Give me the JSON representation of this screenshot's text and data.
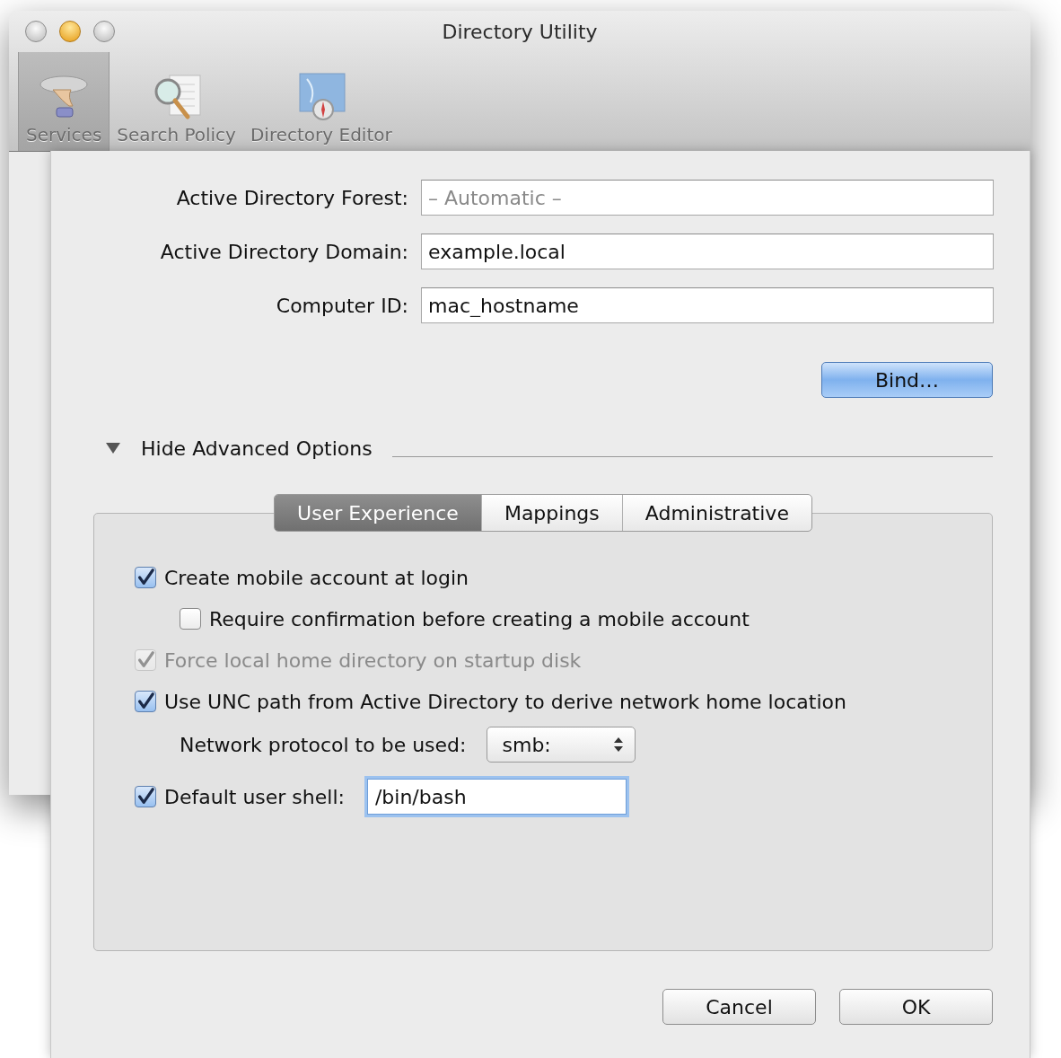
{
  "window": {
    "title": "Directory Utility"
  },
  "toolbar": [
    {
      "label": "Services",
      "selected": true,
      "kind": "services"
    },
    {
      "label": "Search Policy",
      "selected": false,
      "kind": "search"
    },
    {
      "label": "Directory Editor",
      "selected": false,
      "kind": "editor"
    }
  ],
  "sheet": {
    "fields": [
      {
        "label": "Active Directory Forest:",
        "placeholder": "– Automatic –"
      },
      {
        "label": "Active Directory Domain:",
        "value": "example.local"
      },
      {
        "label": "Computer ID:",
        "value": "mac_hostname"
      }
    ],
    "bind_button": {
      "label": "Bind…",
      "default": true
    },
    "disclosure": {
      "label": "Hide Advanced Options",
      "expanded": true
    },
    "tabs": [
      {
        "label": "User Experience",
        "selected": true
      },
      {
        "label": "Mappings",
        "selected": false
      },
      {
        "label": "Administrative",
        "selected": false
      }
    ],
    "options": [
      {
        "kind": "checkbox",
        "label": "Create mobile account at login",
        "checked": true,
        "disabled": false,
        "children": [
          {
            "kind": "checkbox",
            "label": "Require confirmation before creating a mobile account",
            "checked": false,
            "disabled": false
          }
        ]
      },
      {
        "kind": "checkbox",
        "label": "Force local home directory on startup disk",
        "checked": true,
        "disabled": true
      },
      {
        "kind": "checkbox",
        "label": "Use UNC path from Active Directory to derive network home location",
        "checked": true,
        "disabled": false,
        "children": [
          {
            "kind": "popup",
            "label": "Network protocol to be used:",
            "value": "smb:"
          }
        ]
      },
      {
        "kind": "checkbox_field",
        "label": "Default user shell:",
        "checked": true,
        "disabled": false,
        "value": "/bin/bash",
        "focused": true
      }
    ],
    "buttons": [
      {
        "label": "Cancel",
        "default": false
      },
      {
        "label": "OK",
        "default": false
      }
    ]
  }
}
